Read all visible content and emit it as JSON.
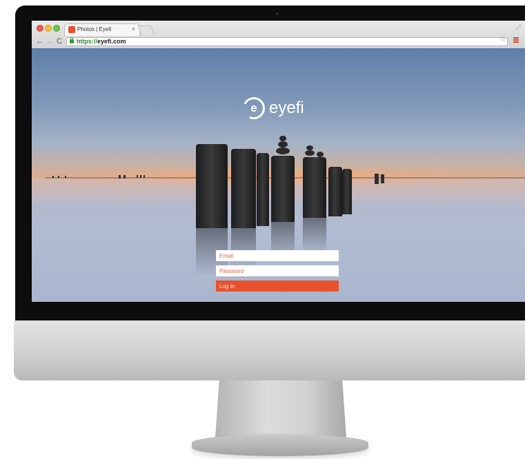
{
  "browser": {
    "tab_title": "Photos | Eyefi",
    "tab_close": "×",
    "url_scheme": "https://",
    "url_host": "eyefi.com"
  },
  "page": {
    "logo_text": "eyefi",
    "logo_mark": "e"
  },
  "login": {
    "email_placeholder": "Email",
    "password_placeholder": "Password",
    "submit_label": "Log In"
  },
  "colors": {
    "accent": "#e8502e",
    "bezel": "#0d0d0d"
  },
  "icons": {
    "back": "arrow-left-icon",
    "forward": "arrow-right-icon",
    "reload": "reload-icon",
    "lock": "lock-icon",
    "bookmark": "star-icon",
    "menu": "hamburger-menu-icon"
  }
}
